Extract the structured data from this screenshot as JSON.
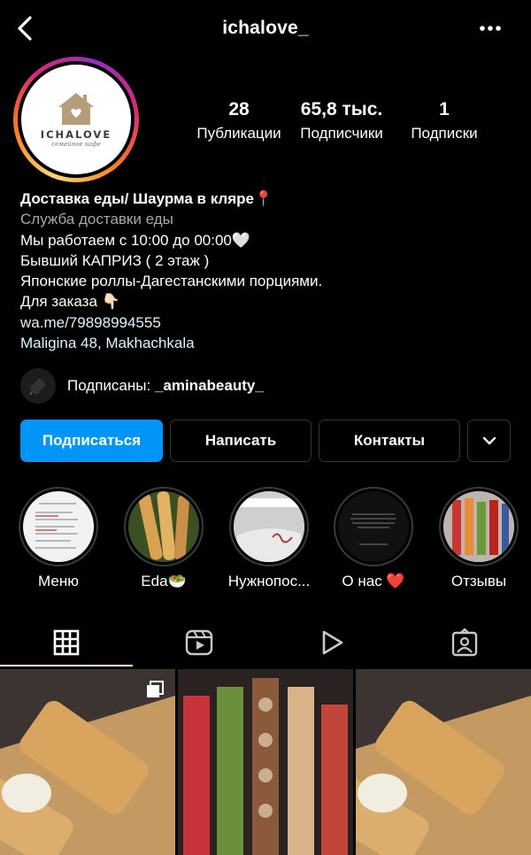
{
  "header": {
    "username": "ichalove_"
  },
  "avatar": {
    "logo_text": "ICHALOVE",
    "logo_sub": "семейное кафе"
  },
  "stats": [
    {
      "value": "28",
      "label": "Публикации"
    },
    {
      "value": "65,8 тыс.",
      "label": "Подписчики"
    },
    {
      "value": "1",
      "label": "Подписки"
    }
  ],
  "bio": {
    "name": "Доставка  еды/ Шаурма в кляре📍",
    "category": "Служба доставки еды",
    "line1": "Мы работаем с 10:00 до 00:00🤍",
    "line2": "Бывший КАПРИЗ ( 2 этаж )",
    "line3": "Японские роллы-Дагестанскими порциями.",
    "line4": "Для заказа 👇🏻",
    "link": "wa.me/79898994555",
    "address": "Maligina 48, Makhachkala"
  },
  "followed_by": {
    "prefix": "Подписаны: ",
    "user": "_aminabeauty_"
  },
  "buttons": {
    "follow": "Подписаться",
    "message": "Написать",
    "contacts": "Контакты"
  },
  "highlights": [
    {
      "label": "Меню"
    },
    {
      "label": "Eda🥗"
    },
    {
      "label": "Нужнопос..."
    },
    {
      "label": "О нас ❤️"
    },
    {
      "label": "Отзывы"
    }
  ],
  "tabs": [
    "grid-icon",
    "reels-icon",
    "video-icon",
    "tagged-icon"
  ],
  "colors": {
    "accent": "#0095f6",
    "background": "#000000",
    "button_border": "#363636",
    "secondary_text": "#a8a8a8"
  }
}
